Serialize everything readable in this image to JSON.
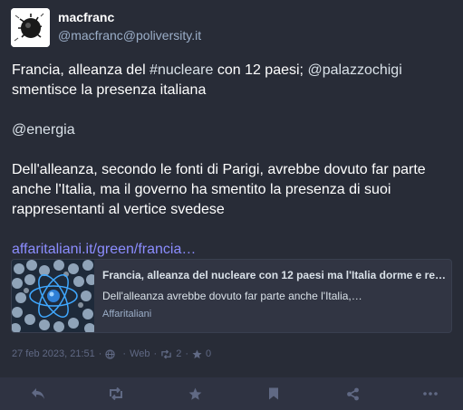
{
  "account": {
    "display_name": "macfranc",
    "handle": "@macfranc@poliversity.it"
  },
  "status": {
    "line1_prefix": "Francia, alleanza del ",
    "hashtag": "#nucleare",
    "line1_middle": " con 12 paesi; ",
    "mention": "@palazzochigi",
    "line1_suffix": " smentisce la presenza italiana",
    "mention2": "@energia",
    "paragraph3": "Dell'alleanza, secondo le fonti di Parigi, avrebbe dovuto far parte anche l'Italia, ma il governo ha smentito la presenza di suoi rappresentanti al vertice svedese",
    "link_text": "affaritaliani.it/green/francia…"
  },
  "card": {
    "title": "Francia, alleanza del nucleare con 12 paesi ma l'Italia dorme e res…",
    "description": "Dell'alleanza avrebbe dovuto far parte anche l'Italia,…",
    "provider": "Affaritaliani"
  },
  "meta": {
    "timestamp": "27 feb 2023, 21:51",
    "dot": "·",
    "application": "Web",
    "boosts": "2",
    "favourites": "0"
  },
  "icons": {
    "reply": "reply-icon",
    "boost": "boost-icon",
    "favourite": "star-icon",
    "bookmark": "bookmark-icon",
    "share": "share-icon",
    "more": "ellipsis-icon"
  },
  "colors": {
    "background": "#282c37",
    "link": "#8c8dff",
    "secondary_text": "#9baec8",
    "meta_text": "#606984"
  }
}
